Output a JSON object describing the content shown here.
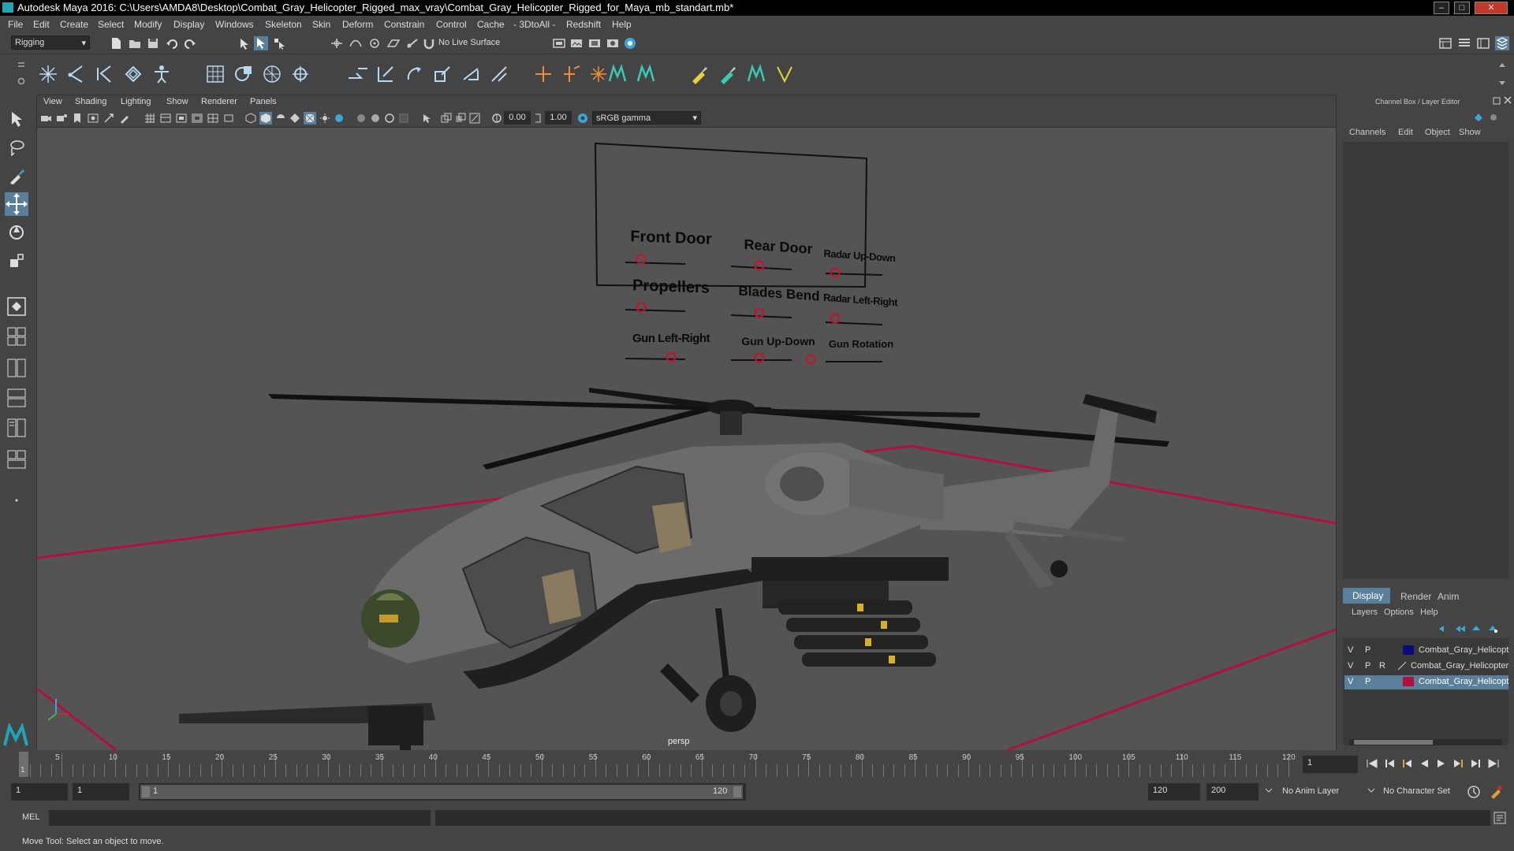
{
  "window": {
    "title": "Autodesk Maya 2016: C:\\Users\\AMDA8\\Desktop\\Combat_Gray_Helicopter_Rigged_max_vray\\Combat_Gray_Helicopter_Rigged_for_Maya_mb_standart.mb*"
  },
  "menu": {
    "file": "File",
    "edit": "Edit",
    "create": "Create",
    "select": "Select",
    "modify": "Modify",
    "display": "Display",
    "windows": "Windows",
    "skeleton": "Skeleton",
    "skin": "Skin",
    "deform": "Deform",
    "constrain": "Constrain",
    "control": "Control",
    "cache": "Cache",
    "dtoall": "- 3DtoAll -",
    "redshift": "Redshift",
    "help": "Help"
  },
  "status": {
    "menuset": "Rigging",
    "live_surface": "No Live Surface"
  },
  "viewport": {
    "menu": {
      "view": "View",
      "shading": "Shading",
      "lighting": "Lighting",
      "show": "Show",
      "renderer": "Renderer",
      "panels": "Panels"
    },
    "exposure": "0.00",
    "gamma": "1.00",
    "color_space": "sRGB gamma",
    "camera_label": "persp",
    "controls": {
      "front_door": "Front Door",
      "rear_door": "Rear Door",
      "radar_up_down": "Radar Up-Down",
      "propellers": "Propellers",
      "blades_bend": "Blades Bend",
      "radar_left_right": "Radar Left-Right",
      "gun_left_right": "Gun Left-Right",
      "gun_up_down": "Gun Up-Down",
      "gun_rotation": "Gun Rotation"
    }
  },
  "channel_box": {
    "title": "Channel Box / Layer Editor",
    "menu": {
      "channels": "Channels",
      "edit": "Edit",
      "object": "Object",
      "show": "Show"
    },
    "tabs": {
      "display": "Display",
      "render": "Render",
      "anim": "Anim"
    },
    "layer_menu": {
      "layers": "Layers",
      "options": "Options",
      "help": "Help"
    },
    "layers": [
      {
        "v": "V",
        "p": "P",
        "r": "",
        "name": "Combat_Gray_Helicopt",
        "color": "#0c0c7a"
      },
      {
        "v": "V",
        "p": "P",
        "r": "R",
        "name": "Combat_Gray_Helicopter",
        "color": ""
      },
      {
        "v": "V",
        "p": "P",
        "r": "",
        "name": "Combat_Gray_Helicopt",
        "color": "#b0103a"
      }
    ]
  },
  "timeline": {
    "ticks": [
      "5",
      "10",
      "15",
      "20",
      "25",
      "30",
      "35",
      "40",
      "45",
      "50",
      "55",
      "60",
      "65",
      "70",
      "75",
      "80",
      "85",
      "90",
      "95",
      "100",
      "105",
      "110",
      "115",
      "120"
    ],
    "start_tick": "1",
    "current_frame": "1"
  },
  "range": {
    "start": "1",
    "playback_start": "1",
    "slider_start": "1",
    "slider_end": "120",
    "playback_end": "120",
    "end": "200",
    "anim_layer": "No Anim Layer",
    "character_set": "No Character Set"
  },
  "command": {
    "mode": "MEL"
  },
  "help_line": "Move Tool: Select an object to move.",
  "colors": {
    "grid_red": "#b01040",
    "selection_blue": "#5db8e8",
    "maya_teal": "#21a4b4"
  }
}
